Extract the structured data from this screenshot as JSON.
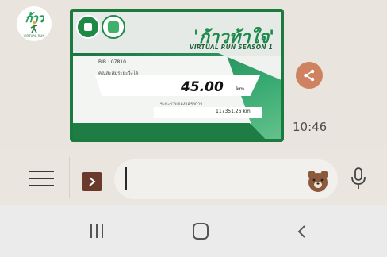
{
  "message": {
    "avatar": {
      "logo_text": "ก้าว",
      "logo_sub": "VIRTUAL RUN"
    },
    "card": {
      "title": "'ก้าวท้าใจ'",
      "subtitle": "VIRTUAL RUN SEASON 1",
      "bib": "BIB : 07810",
      "distance_label": "คุณสะสมระยะวิ่งได้",
      "distance_value": "45.00",
      "distance_unit": "km.",
      "total_label": "ระยะรวมของโครงการ",
      "total_value": "117351.26  km."
    },
    "time": "10:46"
  },
  "input_bar": {
    "placeholder": "",
    "menu_icon": "menu-icon",
    "expand_icon": "chevron-right-icon",
    "sticker_icon": "bear-sticker-icon",
    "mic_icon": "mic-icon"
  },
  "nav": {
    "recents_icon": "recents-icon",
    "home_icon": "home-icon",
    "back_icon": "back-icon"
  },
  "colors": {
    "share": "#cf8260",
    "brand_green": "#1b8a4a",
    "expand": "#6a3a2c"
  }
}
